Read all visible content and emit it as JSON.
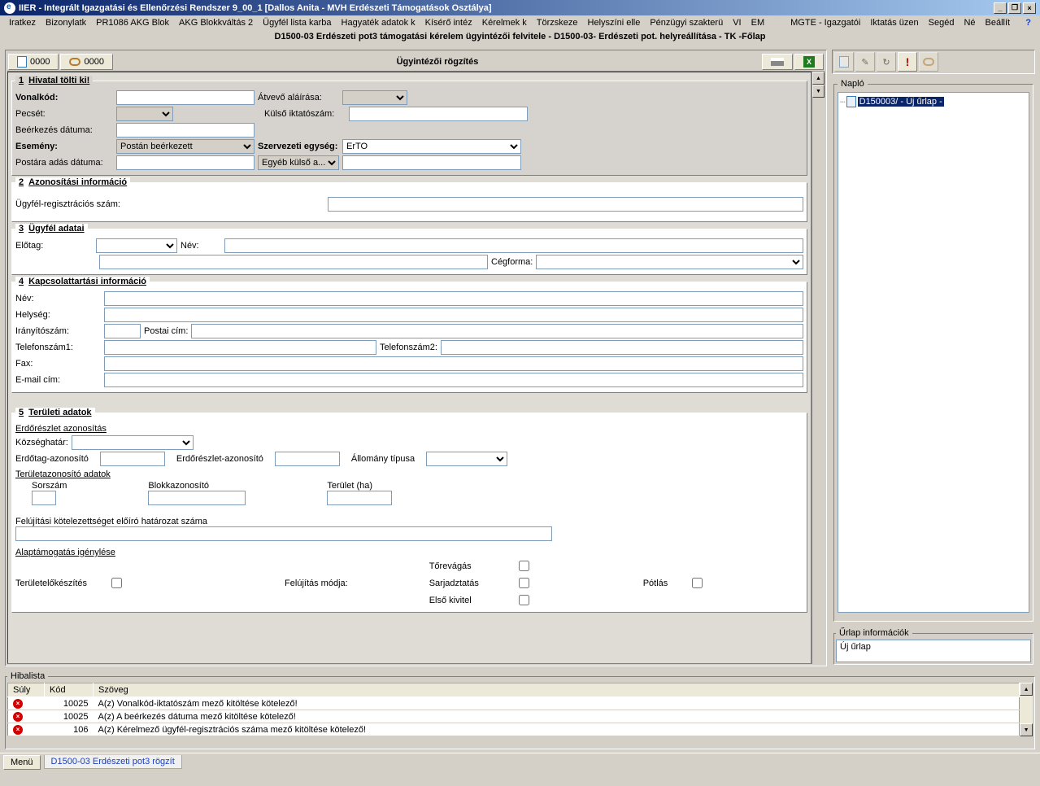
{
  "title": "IIER - Integrált Igazgatási és Ellenőrzési Rendszer 9_00_1 [Dallos Anita - MVH Erdészeti Támogatások Osztálya]",
  "menu": [
    "Iratkez",
    "Bizonylatk",
    "PR1086 AKG Blok",
    "AKG Blokkváltás 2",
    "Ügyfél lista karba",
    "Hagyaték adatok k",
    "Kísérő intéz",
    "Kérelmek k",
    "Törzskeze",
    "Helyszíni elle",
    "Pénzügyi szakterü",
    "VI",
    "EM",
    "",
    "MGTE - Igazgatói",
    "Iktatás üzen",
    "Segéd",
    "Né",
    "Beállít"
  ],
  "subtitle": "D1500-03 Erdészeti pot3 támogatási kérelem ügyintézői felvitele - D1500-03- Erdészeti pot. helyreállítása - TK -Főlap",
  "toolbar": {
    "btn1": "0000",
    "btn2": "0000",
    "title": "Ügyintézői rögzítés"
  },
  "section1": {
    "legend_num": "1",
    "legend_txt": "Hivatal tölti ki!",
    "vonalkod": "Vonalkód:",
    "atvevo": "Átvevő aláírása:",
    "pecset": "Pecsét:",
    "kulso_ikt": "Külső iktatószám:",
    "beerk": "Beérkezés dátuma:",
    "esemeny": "Esemény:",
    "esemeny_val": "Postán beérkezett",
    "szerv": "Szervezeti egység:",
    "szerv_val": "ErTO",
    "postara": "Postára adás dátuma:",
    "egyeb": "Egyéb külső a..."
  },
  "section2": {
    "legend_num": "2",
    "legend_txt": "Azonosítási információ",
    "ugyfel_reg": "Ügyfél-regisztrációs szám:"
  },
  "section3": {
    "legend_num": "3",
    "legend_txt": "Ügyfél adatai",
    "elotag": "Előtag:",
    "nev": "Név:",
    "cegforma": "Cégforma:"
  },
  "section4": {
    "legend_num": "4",
    "legend_txt": "Kapcsolattartási információ",
    "nev": "Név:",
    "helyseg": "Helység:",
    "irsz": "Irányítószám:",
    "postai": "Postai cím:",
    "tel1": "Telefonszám1:",
    "tel2": "Telefonszám2:",
    "fax": "Fax:",
    "email": "E-mail cím:"
  },
  "section5": {
    "legend_num": "5",
    "legend_txt": "Területi adatok",
    "erdo_azon": "Erdőrészlet azonosítás",
    "kozseg": "Községhatár:",
    "erdotag": "Erdőtag-azonosító",
    "erdoresz": "Erdőrészlet-azonosító",
    "allomany": "Állomány típusa",
    "terazon": "Területazonosító adatok",
    "sorszam": "Sorszám",
    "blokk": "Blokkazonosító",
    "terulet": "Terület (ha)",
    "feluj_kot": "Felújítási kötelezettséget előíró határozat száma",
    "alaptam": "Alaptámogatás igénylése",
    "terulet_elo": "Területelőkészítés",
    "feluj_mod": "Felújítás módja:",
    "torevagas": "Tőrevágás",
    "sarjadz": "Sarjadztatás",
    "elsokivitel": "Első kivitel",
    "potlas": "Pótlás"
  },
  "naplo": {
    "title": "Napló",
    "item": "D150003/ - Új űrlap -"
  },
  "urlap_info": {
    "title": "Űrlap információk",
    "value": "Új űrlap"
  },
  "hibalista": {
    "title": "Hibalista",
    "cols": [
      "Súly",
      "Kód",
      "Szöveg"
    ],
    "rows": [
      {
        "kod": "10025",
        "szoveg": "A(z) Vonalkód-iktatószám mező kitöltése kötelező!"
      },
      {
        "kod": "10025",
        "szoveg": "A(z) A beérkezés dátuma mező kitöltése kötelező!"
      },
      {
        "kod": "106",
        "szoveg": "A(z) Kérelmező ügyfél-regisztrációs száma mező kitöltése kötelező!"
      }
    ]
  },
  "status": {
    "menu": "Menü",
    "tab": "D1500-03 Erdészeti pot3 rögzít"
  }
}
